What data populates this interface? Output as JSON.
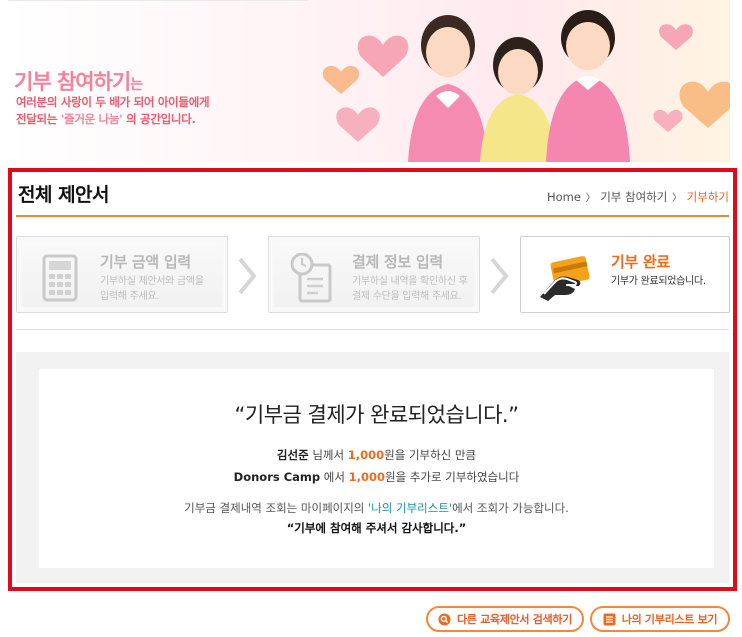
{
  "banner": {
    "title_main": "기부 참여하기",
    "title_suffix": "는",
    "line1": "여러분의 사랑이 두 배가 되어 아이들에게",
    "line2_prefix": "전달되는 ",
    "line2_highlight": "'즐거운 나눔'",
    "line2_suffix": " 의 공간입니다."
  },
  "page": {
    "title": "전체 제안서",
    "breadcrumb": [
      {
        "label": "Home"
      },
      {
        "label": "기부 참여하기"
      },
      {
        "label": "기부하기"
      }
    ],
    "breadcrumb_sep": "〉"
  },
  "steps": [
    {
      "title": "기부 금액 입력",
      "desc": "기부하실 제안서와 금액을\n입력해 주세요.",
      "icon": "calculator-icon",
      "state": "done"
    },
    {
      "title": "결제 정보 입력",
      "desc": "기부하실 내역을 확인하신 후\n결제 수단을 입력해 주세요.",
      "icon": "clock-document-icon",
      "state": "done"
    },
    {
      "title": "기부 완료",
      "desc": "기부가 완료되었습니다.",
      "icon": "card-hand-icon",
      "state": "active"
    }
  ],
  "result": {
    "heading": "“기부금 결제가 완료되었습니다.”",
    "donor_name": "김선준",
    "line1_mid": " 님께서 ",
    "donor_amount": "1,000",
    "line1_end": "원을 기부하신 만큼",
    "org_name": "Donors Camp",
    "line2_mid": " 에서 ",
    "matched_amount": "1,000",
    "line2_end": "원을 추가로 기부하였습니다",
    "line3_prefix": "기부금 결제내역 조회는 마이페이지의 ",
    "line3_link": "'나의 기부리스트'",
    "line3_suffix": "에서 조회가 가능합니다.",
    "thanks": "“기부에 참여해 주셔서 감사합니다.”"
  },
  "buttons": {
    "search_other": "다른 교육제안서 검색하기",
    "my_list": "나의 기부리스트 보기"
  },
  "colors": {
    "frame_border": "#e00a1b",
    "accent_orange": "#ee6a1c",
    "banner_pink": "#f3829a",
    "link_teal": "#1a8f9b"
  }
}
